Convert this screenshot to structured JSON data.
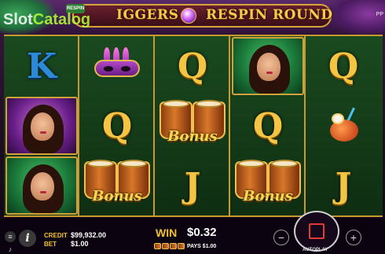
{
  "header": {
    "watermark_main": "Slot",
    "watermark_sub": "Catalog",
    "respin_badge": "RESPIN",
    "title_left": "IGGERS",
    "title_right": "RESPIN ROUND",
    "corner": "PP"
  },
  "reels": {
    "col1": [
      "K",
      "portrait-purple-woman",
      "portrait-green-woman"
    ],
    "col2": [
      "mask",
      "Q",
      "Bonus"
    ],
    "col3": [
      "Q",
      "Bonus",
      "J"
    ],
    "col4": [
      "portrait-green-woman",
      "Q",
      "Bonus"
    ],
    "col5": [
      "Q",
      "coconut-drink",
      "J"
    ],
    "bonus_label": "Bonus"
  },
  "footer": {
    "credit_label": "CREDIT",
    "credit_value": "$99,932.00",
    "bet_label": "BET",
    "bet_value": "$1.00",
    "win_label": "WIN",
    "win_value": "$0.32",
    "pays_text": "PAYS $1.00",
    "autoplay_label": "AUTOPLAY",
    "minus": "−",
    "plus": "+",
    "info": "i"
  },
  "colors": {
    "gold": "#f2c32f",
    "frame": "#c79a2e",
    "reel_bg": "#1a4a1f",
    "spin_accent": "#e03a3a"
  },
  "icons": [
    "menu-icon",
    "sound-icon",
    "info-icon",
    "minus-icon",
    "plus-icon",
    "spin-icon"
  ]
}
